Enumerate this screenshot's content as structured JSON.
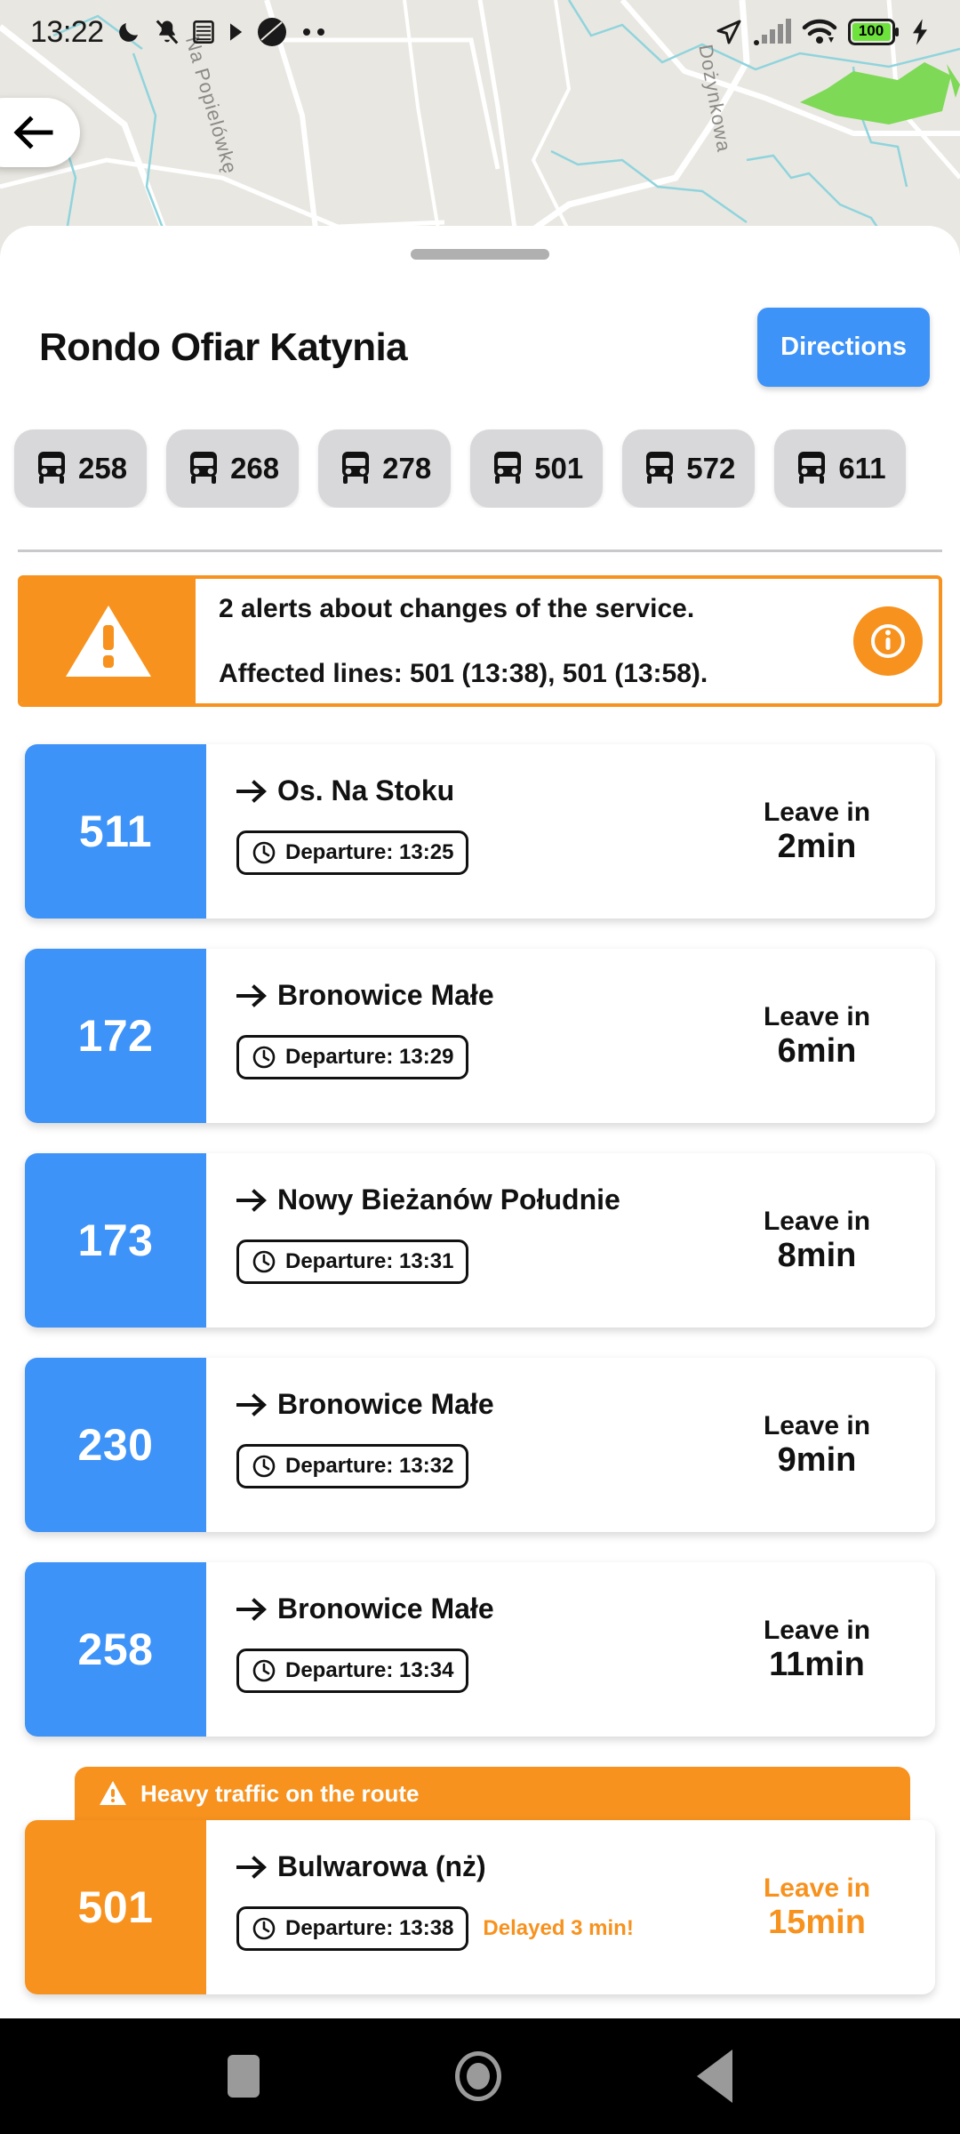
{
  "statusbar": {
    "time": "13:22",
    "battery_level": "100",
    "left_icons": [
      "moon-icon",
      "mute-bell-icon",
      "calendar-icon",
      "play-icon",
      "circle-icon",
      "more-dots-icon"
    ],
    "right_icons": [
      "navigation-arrow-icon",
      "cellular-signal-icon",
      "wifi-icon",
      "battery-icon",
      "charging-bolt-icon"
    ]
  },
  "map": {
    "street_labels": [
      "Na Popielówkę",
      "Dożynkowa"
    ],
    "background_color": "#e9e7e1",
    "road_color": "#ffffff",
    "water_color": "#8fd4dd",
    "park_color": "#7ed957"
  },
  "back_button": {
    "icon": "arrow-left-icon"
  },
  "sheet": {
    "title": "Rondo Ofiar Katynia",
    "directions_label": "Directions",
    "directions_color": "#3d93f7"
  },
  "line_chips": [
    {
      "icon": "bus-icon",
      "label": "258"
    },
    {
      "icon": "bus-icon",
      "label": "268"
    },
    {
      "icon": "bus-icon",
      "label": "278"
    },
    {
      "icon": "bus-icon",
      "label": "501"
    },
    {
      "icon": "bus-icon",
      "label": "572"
    },
    {
      "icon": "bus-icon",
      "label": "611"
    }
  ],
  "alert": {
    "icon": "warning-triangle-icon",
    "line1": "2 alerts about changes of the service.",
    "line2": "Affected lines: 501 (13:38), 501 (13:58).",
    "info_icon": "info-circle-icon",
    "accent_color": "#f7921e"
  },
  "departures": [
    {
      "line": "511",
      "destination": "Os. Na Stoku",
      "departure_label": "Departure: 13:25",
      "leave_label": "Leave in",
      "leave_value": "2min",
      "delay": null,
      "banner": null,
      "alerted": false
    },
    {
      "line": "172",
      "destination": "Bronowice Małe",
      "departure_label": "Departure: 13:29",
      "leave_label": "Leave in",
      "leave_value": "6min",
      "delay": null,
      "banner": null,
      "alerted": false
    },
    {
      "line": "173",
      "destination": "Nowy Bieżanów Południe",
      "departure_label": "Departure: 13:31",
      "leave_label": "Leave in",
      "leave_value": "8min",
      "delay": null,
      "banner": null,
      "alerted": false
    },
    {
      "line": "230",
      "destination": "Bronowice Małe",
      "departure_label": "Departure: 13:32",
      "leave_label": "Leave in",
      "leave_value": "9min",
      "delay": null,
      "banner": null,
      "alerted": false
    },
    {
      "line": "258",
      "destination": "Bronowice Małe",
      "departure_label": "Departure: 13:34",
      "leave_label": "Leave in",
      "leave_value": "11min",
      "delay": null,
      "banner": null,
      "alerted": false
    },
    {
      "line": "501",
      "destination": "Bulwarowa (nż)",
      "departure_label": "Departure: 13:38",
      "leave_label": "Leave in",
      "leave_value": "15min",
      "delay": "Delayed 3 min!",
      "banner": "Heavy traffic on the route",
      "alerted": true
    }
  ],
  "navbar": {
    "recents": "recents-square-icon",
    "home": "home-circle-icon",
    "back": "back-triangle-icon"
  }
}
